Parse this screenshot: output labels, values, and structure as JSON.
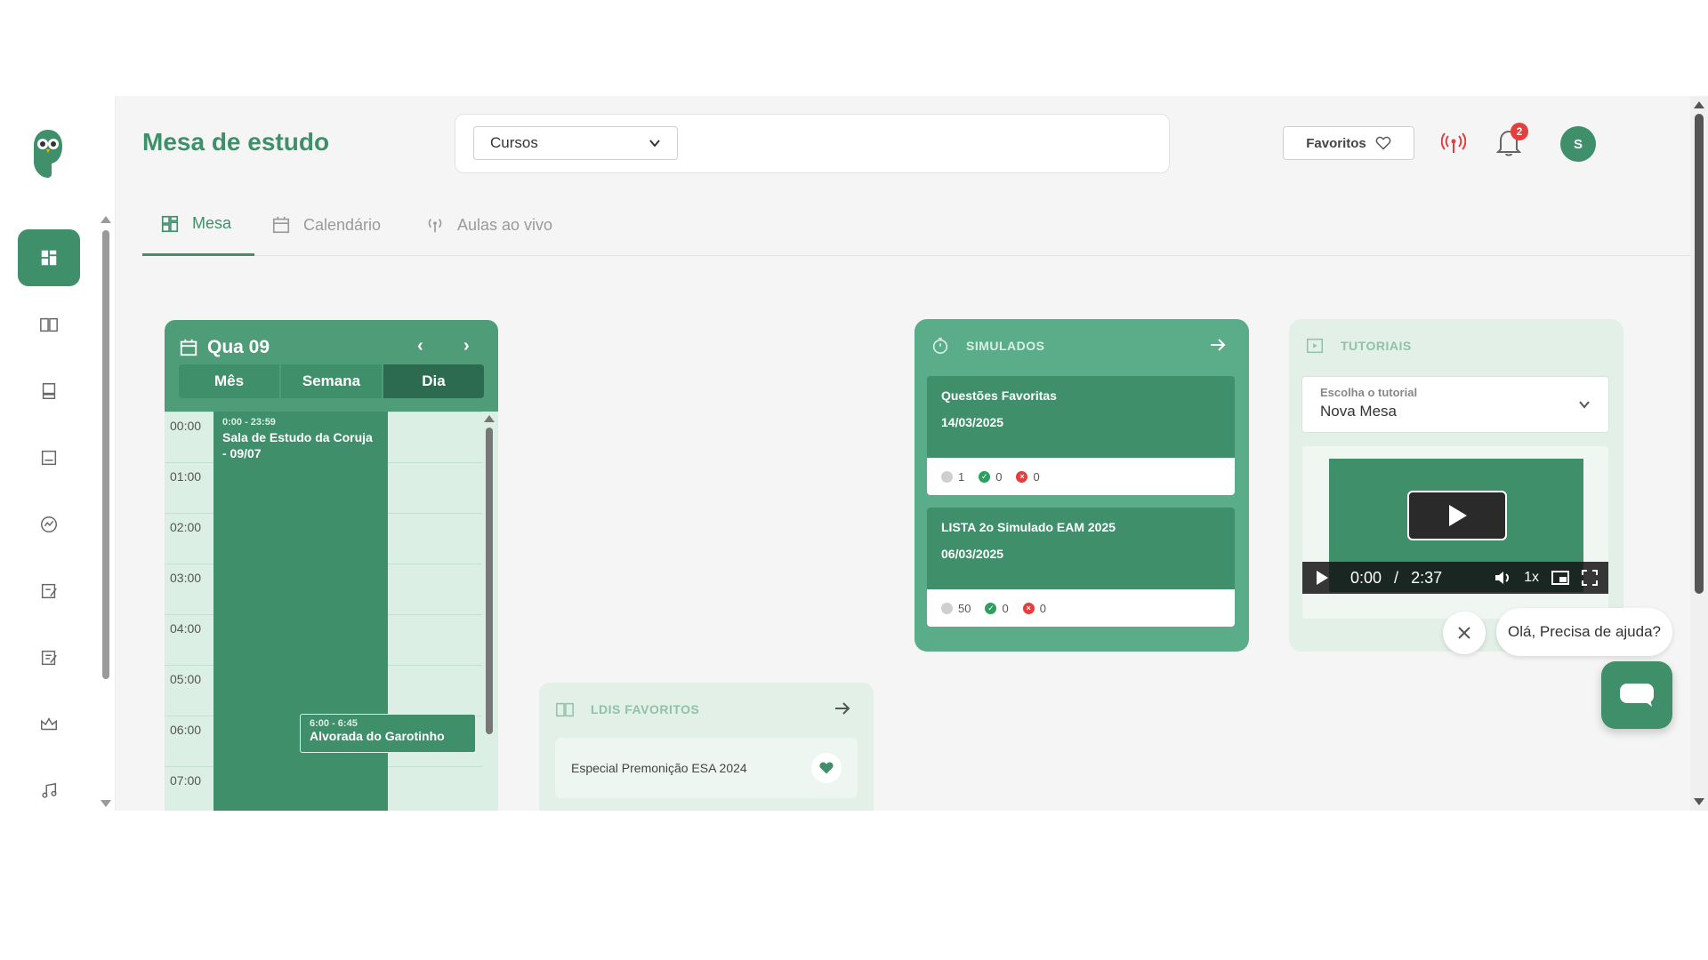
{
  "header": {
    "title": "Mesa de estudo",
    "cursos_label": "Cursos",
    "favoritos_label": "Favoritos",
    "notification_count": "2",
    "avatar_initial": "S"
  },
  "tabs": [
    {
      "label": "Mesa",
      "icon": "grid-icon",
      "active": true
    },
    {
      "label": "Calendário",
      "icon": "calendar-icon",
      "active": false
    },
    {
      "label": "Aulas ao vivo",
      "icon": "broadcast-icon",
      "active": false
    }
  ],
  "sidebar": {
    "items": [
      {
        "icon": "dashboard-icon",
        "active": true
      },
      {
        "icon": "book-open-icon"
      },
      {
        "icon": "book-icon"
      },
      {
        "icon": "notebook-icon"
      },
      {
        "icon": "chart-icon"
      },
      {
        "icon": "edit-icon"
      },
      {
        "icon": "edit-list-icon"
      },
      {
        "icon": "crown-icon"
      },
      {
        "icon": "music-icon"
      }
    ]
  },
  "calendar": {
    "date_label": "Qua 09",
    "views": [
      "Mês",
      "Semana",
      "Dia"
    ],
    "active_view": "Dia",
    "hours": [
      "00:00",
      "01:00",
      "02:00",
      "03:00",
      "04:00",
      "05:00",
      "06:00",
      "07:00"
    ],
    "events": [
      {
        "time": "0:00 - 23:59",
        "name": "Sala de Estudo da Coruja - 09/07"
      },
      {
        "time": "6:00 - 6:45",
        "name": "Alvorada do Garotinho"
      }
    ]
  },
  "ldis": {
    "title": "LDIS FAVORITOS",
    "items": [
      "Especial Premonição ESA 2024"
    ]
  },
  "simulados": {
    "title": "SIMULADOS",
    "items": [
      {
        "title": "Questões Favoritas",
        "date": "14/03/2025",
        "pending": "1",
        "correct": "0",
        "wrong": "0"
      },
      {
        "title": "LISTA 2o Simulado EAM 2025",
        "date": "06/03/2025",
        "pending": "50",
        "correct": "0",
        "wrong": "0"
      }
    ]
  },
  "tutoriais": {
    "title": "TUTORIAIS",
    "select_label": "Escolha o tutorial",
    "select_value": "Nova Mesa",
    "video_time": "0:00",
    "video_sep": "/",
    "video_duration": "2:37",
    "video_speed": "1x"
  },
  "help": {
    "bubble_text": "Olá, Precisa de ajuda?"
  },
  "colors": {
    "brand": "#3f8f6b",
    "brand_light": "#5aad88",
    "card_light": "#e2f0e8",
    "badge": "#e53e3e"
  }
}
